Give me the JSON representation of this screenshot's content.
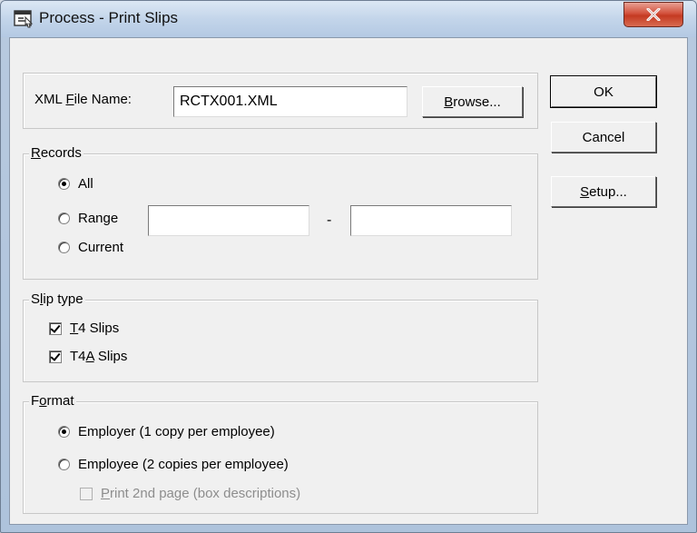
{
  "window": {
    "title": "Process - Print Slips",
    "close_label": "X"
  },
  "file": {
    "label_prefix": "XML ",
    "label_accel": "F",
    "label_suffix": "ile Name:",
    "value": "RCTX001.XML",
    "browse_accel": "B",
    "browse_suffix": "rowse..."
  },
  "records": {
    "legend_accel": "R",
    "legend_suffix": "ecords",
    "options": [
      "All",
      "Range",
      "Current"
    ],
    "selected": "All",
    "range_from": "",
    "range_to": "",
    "range_separator": "-"
  },
  "slip_type": {
    "legend_prefix": "S",
    "legend_accel": "l",
    "legend_suffix": "ip type",
    "t4_accel": "T",
    "t4_suffix": "4 Slips",
    "t4_checked": true,
    "t4a_prefix": "T4",
    "t4a_accel": "A",
    "t4a_suffix": " Slips",
    "t4a_checked": true
  },
  "format": {
    "legend_prefix": "F",
    "legend_accel": "o",
    "legend_suffix": "rmat",
    "employer_label": "Employer (1 copy per employee)",
    "employee_label": "Employee (2 copies per employee)",
    "selected": "Employer",
    "print2nd_accel": "P",
    "print2nd_suffix": "rint 2nd page (box descriptions)",
    "print2nd_checked": false,
    "print2nd_enabled": false
  },
  "buttons": {
    "ok": "OK",
    "cancel": "Cancel",
    "setup_accel": "S",
    "setup_suffix": "etup..."
  },
  "icons": {
    "title_icon": "print-slips-window-icon",
    "close": "close-icon"
  },
  "colors": {
    "close_button": "#c43a22",
    "dialog_face": "#f0f0f0"
  }
}
